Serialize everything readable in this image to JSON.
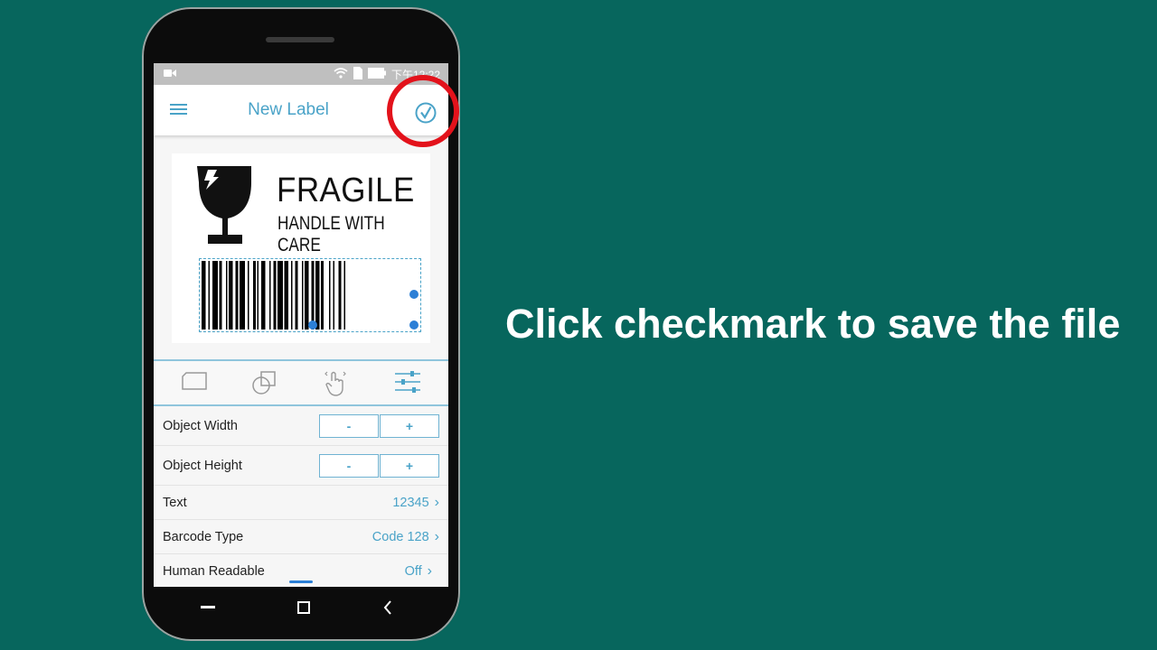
{
  "status": {
    "time": "下午12:22"
  },
  "appbar": {
    "title": "New Label"
  },
  "label": {
    "line1": "FRAGILE",
    "line2": "HANDLE WITH CARE"
  },
  "toolbar": {
    "icons": [
      "page-icon",
      "shapes-icon",
      "touch-icon",
      "sliders-icon"
    ]
  },
  "properties": {
    "width": {
      "label": "Object Width",
      "minus": "-",
      "plus": "+"
    },
    "height": {
      "label": "Object Height",
      "minus": "-",
      "plus": "+"
    },
    "text": {
      "label": "Text",
      "value": "12345"
    },
    "barcode_type": {
      "label": "Barcode Type",
      "value": "Code 128"
    },
    "human_readable": {
      "label": "Human Readable",
      "value": "Off"
    }
  },
  "caption": "Click checkmark to save the file",
  "colors": {
    "background": "#07665d",
    "accent": "#4aa3c8",
    "highlight": "#e3121b"
  }
}
